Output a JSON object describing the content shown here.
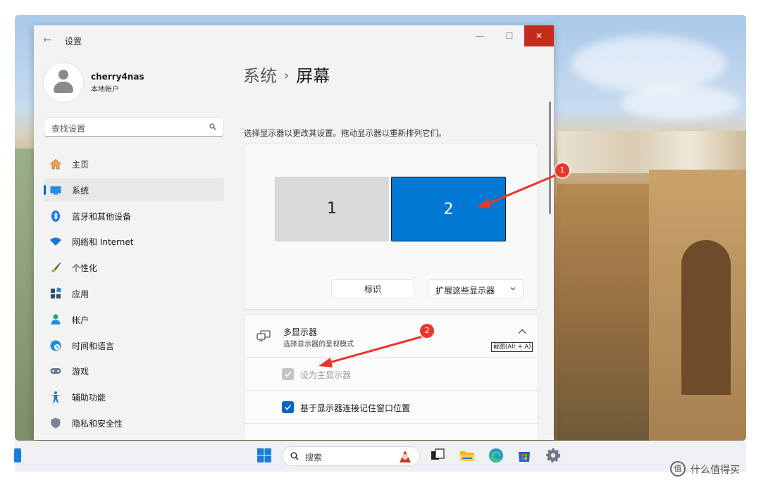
{
  "window": {
    "back": "←",
    "title": "设置",
    "minimize": "—",
    "maximize": "☐",
    "close": "✕"
  },
  "profile": {
    "name": "cherry4nas",
    "account_type": "本地帐户"
  },
  "search": {
    "placeholder": "查找设置"
  },
  "sidebar": {
    "items": [
      {
        "label": "主页",
        "icon": "home-icon",
        "active": false
      },
      {
        "label": "系统",
        "icon": "monitor-icon",
        "active": true
      },
      {
        "label": "蓝牙和其他设备",
        "icon": "bluetooth-icon",
        "active": false
      },
      {
        "label": "网络和 Internet",
        "icon": "wifi-icon",
        "active": false
      },
      {
        "label": "个性化",
        "icon": "brush-icon",
        "active": false
      },
      {
        "label": "应用",
        "icon": "apps-icon",
        "active": false
      },
      {
        "label": "帐户",
        "icon": "person-icon",
        "active": false
      },
      {
        "label": "时间和语言",
        "icon": "clock-globe-icon",
        "active": false
      },
      {
        "label": "游戏",
        "icon": "gamepad-icon",
        "active": false
      },
      {
        "label": "辅助功能",
        "icon": "accessibility-icon",
        "active": false
      },
      {
        "label": "隐私和安全性",
        "icon": "shield-icon",
        "active": false
      }
    ]
  },
  "main": {
    "breadcrumb_parent": "系统",
    "breadcrumb_sep": "›",
    "breadcrumb_current": "屏幕",
    "description": "选择显示器以更改其设置。拖动显示器以重新排列它们。",
    "monitors": [
      {
        "label": "1",
        "selected": false
      },
      {
        "label": "2",
        "selected": true
      }
    ],
    "identify_label": "标识",
    "extend_label": "扩展这些显示器",
    "multi_display": {
      "title": "多显示器",
      "subtitle": "选择显示器的呈现模式",
      "shortcut_tip": "截图(Alt + A)",
      "options": [
        {
          "label": "设为主显示器",
          "checked": true,
          "disabled": true
        },
        {
          "label": "基于显示器连接记住窗口位置",
          "checked": true,
          "disabled": false
        }
      ]
    }
  },
  "annotations": {
    "badge_1": "1",
    "badge_2": "2"
  },
  "taskbar": {
    "search_label": "搜索"
  },
  "watermark": {
    "logo": "值",
    "text": "什么值得买"
  },
  "colors": {
    "accent": "#0067c0",
    "selected_monitor": "#0078d4",
    "close": "#c42b1c",
    "annotation_red": "#e8372b"
  }
}
